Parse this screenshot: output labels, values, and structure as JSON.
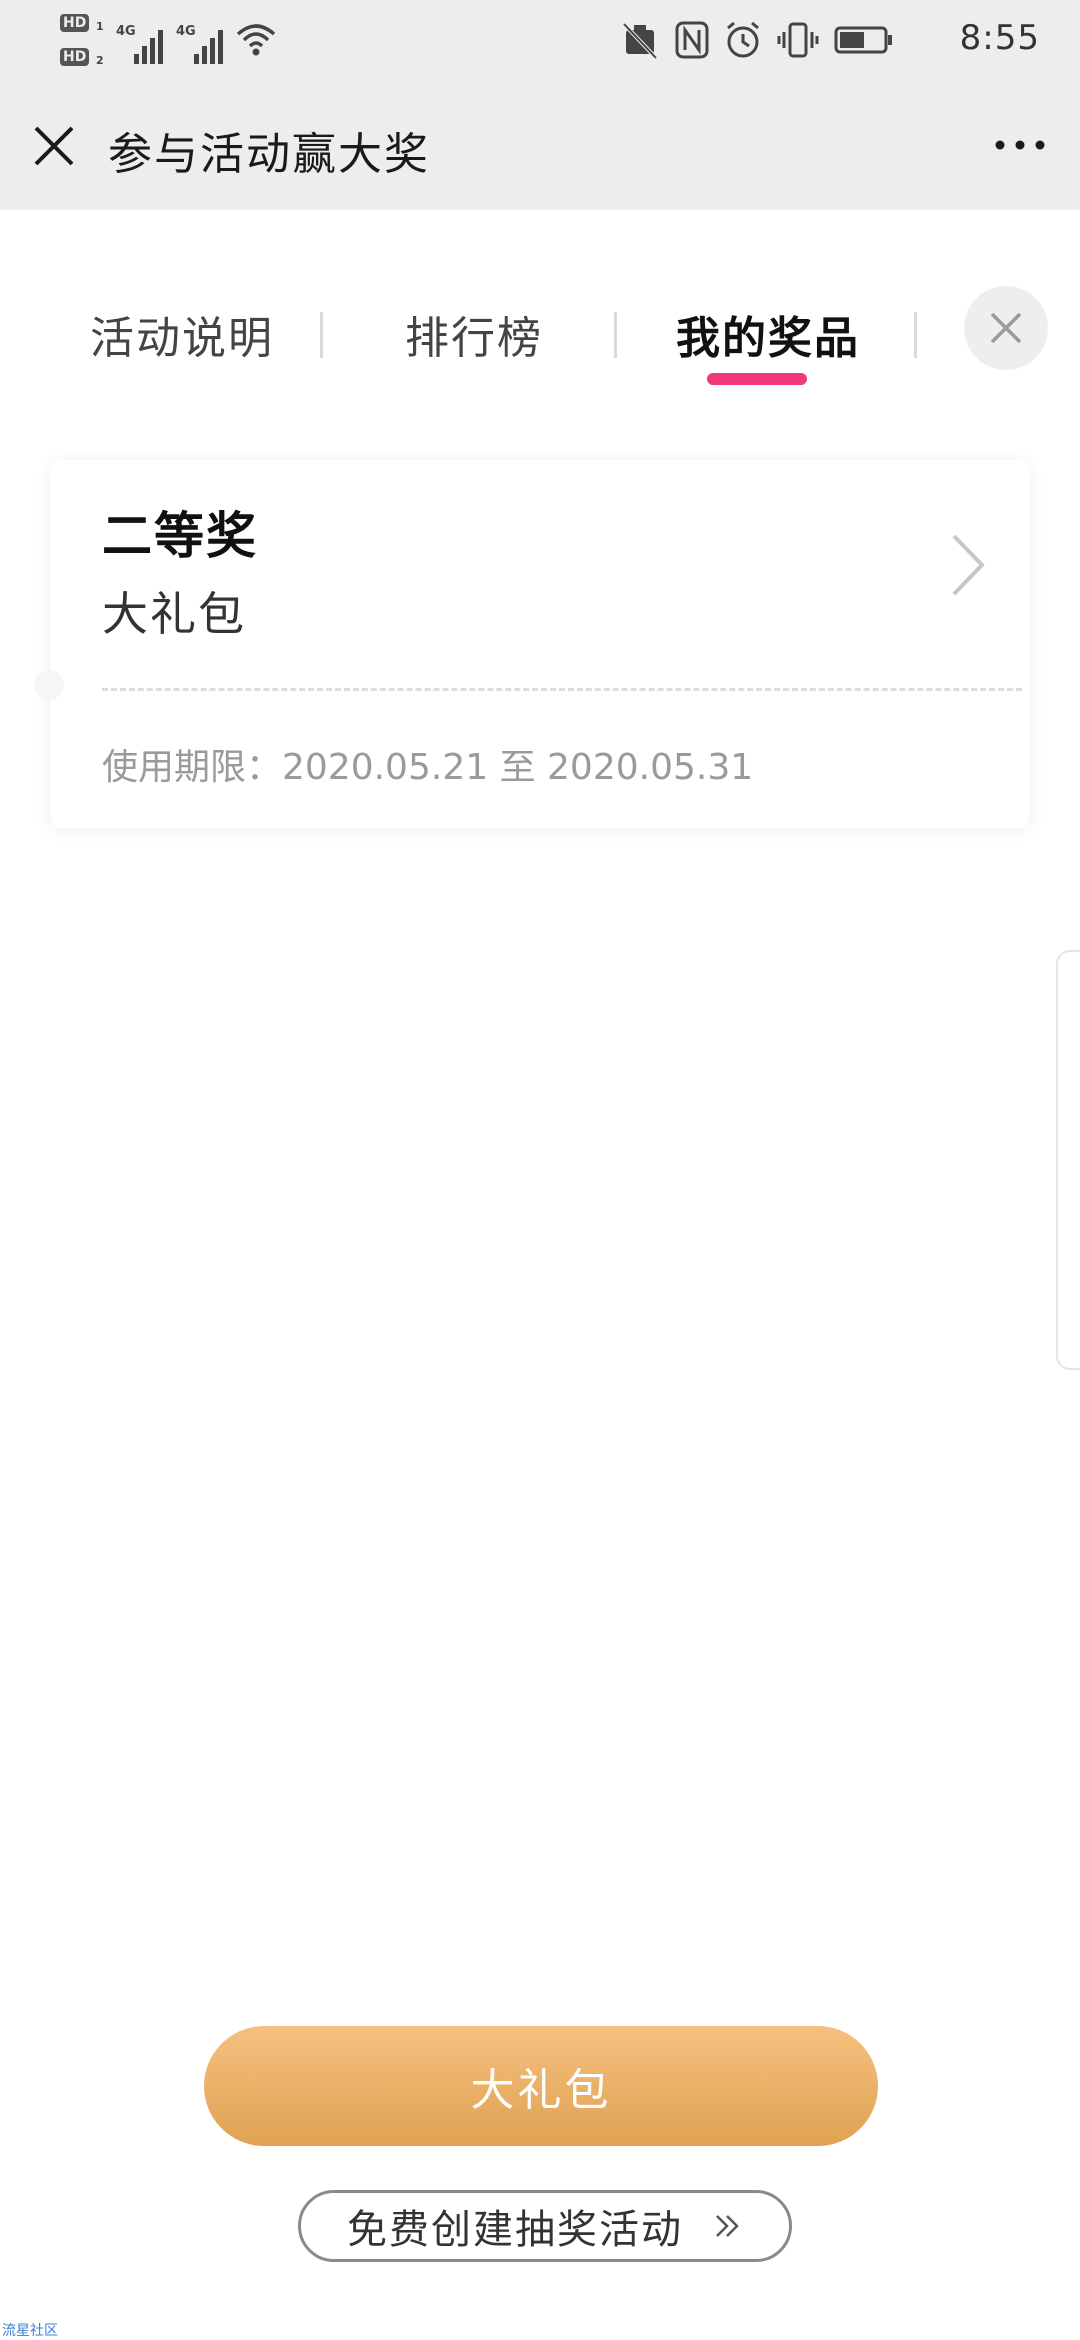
{
  "status_bar": {
    "hd1": "HD",
    "hd1_num": "1",
    "hd2": "HD",
    "hd2_num": "2",
    "network1": "4G",
    "network2": "4G",
    "time": "8:55",
    "icons": [
      "no-sim-icon",
      "nfc-icon",
      "alarm-icon",
      "vibrate-icon",
      "battery-icon"
    ]
  },
  "nav": {
    "title": "参与活动赢大奖",
    "close_icon": "close-icon",
    "more_icon": "more-icon"
  },
  "tabs": {
    "items": [
      {
        "label": "活动说明"
      },
      {
        "label": "排行榜"
      },
      {
        "label": "我的奖品"
      }
    ],
    "active_index": 2,
    "accent_color": "#f0397a"
  },
  "prize": {
    "level": "二等奖",
    "name": "大礼包",
    "validity": "使用期限：2020.05.21 至 2020.05.31"
  },
  "buttons": {
    "primary_label": "大礼包",
    "secondary_label": "免费创建抽奖活动",
    "primary_color": "#e8ad66"
  },
  "watermark": "流星社区"
}
